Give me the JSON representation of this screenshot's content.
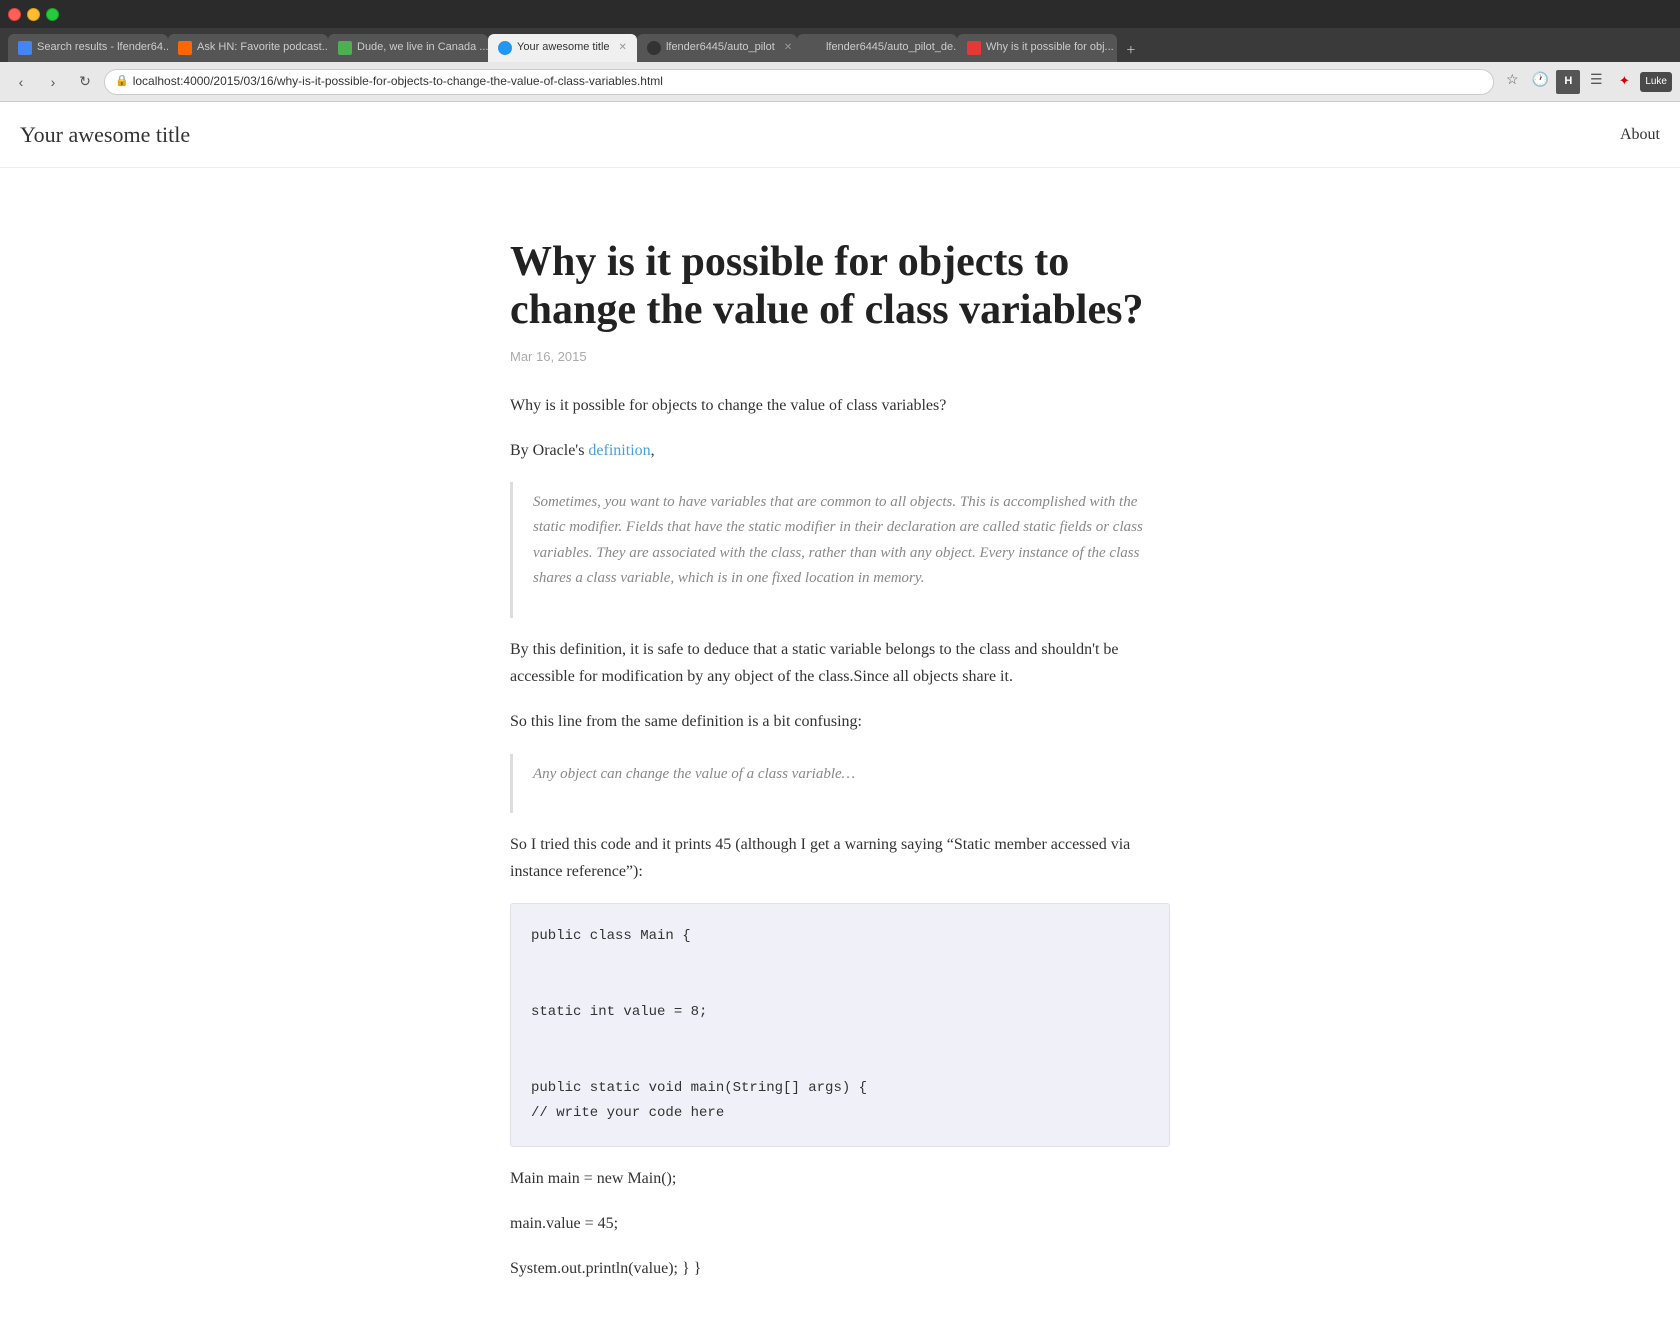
{
  "browser": {
    "tabs": [
      {
        "id": "tab-1",
        "label": "Search results - lfender64...",
        "favicon_class": "search",
        "active": false
      },
      {
        "id": "tab-2",
        "label": "Ask HN: Favorite podcast...",
        "favicon_class": "hn",
        "active": false
      },
      {
        "id": "tab-3",
        "label": "Dude, we live in Canada ...",
        "favicon_class": "green",
        "active": false
      },
      {
        "id": "tab-4",
        "label": "Your awesome title",
        "favicon_class": "blue-circle",
        "active": true
      },
      {
        "id": "tab-5",
        "label": "lfender6445/auto_pilot",
        "favicon_class": "github",
        "active": false
      },
      {
        "id": "tab-6",
        "label": "lfender6445/auto_pilot_de...",
        "favicon_class": "github2",
        "active": false
      },
      {
        "id": "tab-7",
        "label": "Why is it possible for obj...",
        "favicon_class": "red",
        "active": false
      }
    ],
    "address": "localhost:4000/2015/03/16/why-is-it-possible-for-objects-to-change-the-value-of-class-variables.html",
    "user_label": "Luke"
  },
  "site": {
    "title": "Your awesome title",
    "nav": {
      "about_label": "About"
    }
  },
  "post": {
    "title": "Why is it possible for objects to change the value of class variables?",
    "date": "Mar 16, 2015",
    "paragraphs": {
      "intro": "Why is it possible for objects to change the value of class variables?",
      "by_oracle": "By Oracle's",
      "definition_link": "definition",
      "definition_suffix": ",",
      "blockquote1": "Sometimes, you want to have variables that are common to all objects. This is accomplished with the static modifier. Fields that have the static modifier in their declaration are called static fields or class variables. They are associated with the class, rather than with any object. Every instance of the class shares a class variable, which is in one fixed location in memory.",
      "para2": "By this definition, it is safe to deduce that a static variable belongs to the class and shouldn't be accessible for modification by any object of the class.Since all objects share it.",
      "para3": "So this line from the same definition is a bit confusing:",
      "blockquote2": "Any object can change the value of a class variable…",
      "para4": "So I tried this code and it prints 45 (although I get a warning saying “Static member accessed via instance reference”):",
      "code": "public class Main {\n\n\nstatic int value = 8;\n\n\npublic static void main(String[] args) {\n// write your code here",
      "para5": "Main main = new Main();",
      "para6": "main.value = 45;",
      "para7": "System.out.println(value); } }"
    }
  }
}
